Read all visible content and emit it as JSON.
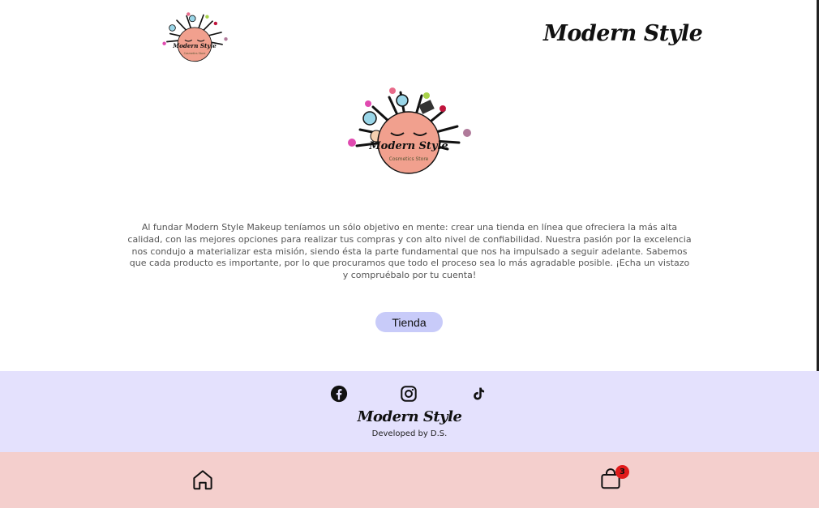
{
  "header": {
    "brand_title": "Modern Style",
    "logo_text": "Modern Style",
    "logo_subtext": "Cosmetics Store"
  },
  "main": {
    "about_text": "Al fundar Modern Style Makeup teníamos un sólo objetivo en mente: crear una tienda en línea que ofreciera la más alta calidad, con las mejores opciones para realizar tus compras y con alto nivel de confiabilidad. Nuestra pasión por la excelencia nos condujo a materializar esta misión, siendo ésta la parte fundamental que nos ha impulsado a seguir adelante. Sabemos que cada producto es importante, por lo que procuramos que todo el proceso sea lo más agradable posible. ¡Echa un vistazo y compruébalo por tu cuenta!",
    "shop_button_label": "Tienda"
  },
  "footer": {
    "social_icons": [
      "facebook-icon",
      "instagram-icon",
      "tiktok-icon"
    ],
    "brand": "Modern Style",
    "credit": "Developed by D.S."
  },
  "bottom_nav": {
    "home_icon": "home-icon",
    "cart_icon": "shopping-bag-icon",
    "cart_count": "3"
  },
  "colors": {
    "footer_bg": "#e4e1fd",
    "nav_bg": "#f4cfcd",
    "button_bg": "#c8cbf9",
    "logo_face": "#f1a08e",
    "badge": "#e01a1a"
  }
}
